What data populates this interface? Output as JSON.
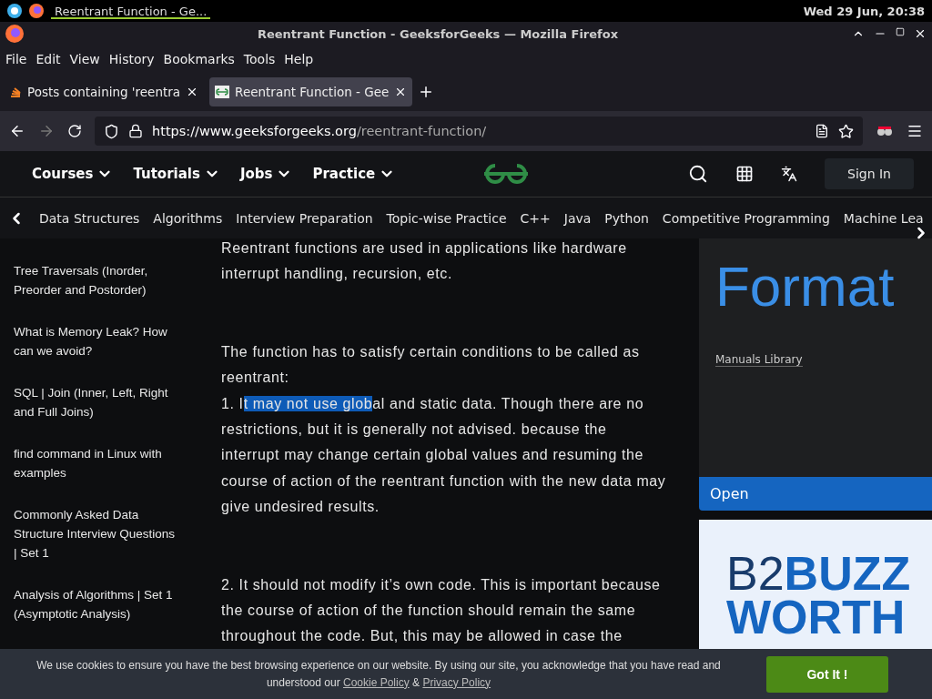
{
  "top_panel": {
    "task": "Reentrant Function - Ge...",
    "clock": "Wed 29 Jun, 20:38"
  },
  "window": {
    "title": "Reentrant Function - GeeksforGeeks — Mozilla Firefox"
  },
  "menu": [
    "File",
    "Edit",
    "View",
    "History",
    "Bookmarks",
    "Tools",
    "Help"
  ],
  "tabs": [
    {
      "label": "Posts containing 'reentra",
      "selected": false
    },
    {
      "label": "Reentrant Function - Gee",
      "selected": true
    }
  ],
  "url": {
    "host": "https://www.geeksforgeeks.org",
    "path": "/reentrant-function/"
  },
  "site_nav": {
    "items": [
      "Courses",
      "Tutorials",
      "Jobs",
      "Practice"
    ],
    "sign_in": "Sign In"
  },
  "categories": [
    "Data Structures",
    "Algorithms",
    "Interview Preparation",
    "Topic-wise Practice",
    "C++",
    "Java",
    "Python",
    "Competitive Programming",
    "Machine Lea"
  ],
  "sidebar": [
    "Tree Traversals (Inorder, Preorder and Postorder)",
    "What is Memory Leak? How can we avoid?",
    "SQL | Join (Inner, Left, Right and Full Joins)",
    "find command in Linux with examples",
    "Commonly Asked Data Structure Interview Questions | Set 1",
    "Analysis of Algorithms | Set 1 (Asymptotic Analysis)"
  ],
  "article": [
    [
      [
        {
          "text": "Reentrant functions are used in applications like hardware interrupt handling, recursion, etc.",
          "highlighted": false
        }
      ]
    ],
    [
      [
        {
          "text": "The function has to satisfy certain conditions to be called as reentrant:",
          "highlighted": false
        }
      ],
      [
        {
          "text": "1. I",
          "highlighted": false
        },
        {
          "text": "t may not use glob",
          "highlighted": true
        },
        {
          "text": "al and static data. Though there are no restrictions, but it is generally not advised. because the interrupt may change certain global values and resuming the course of action of the reentrant function with the new data may give undesired results.",
          "highlighted": false
        }
      ]
    ],
    [
      [
        {
          "text": "2. It should not modify it’s own code. This is important because the course of action of the function should remain the same throughout the code. But, this may be allowed in case the",
          "highlighted": false
        }
      ]
    ]
  ],
  "ad": {
    "headline": "Format",
    "brand": "Manuals Library",
    "button": "Open",
    "banner_light": "B2",
    "banner_bold": "BUZZ",
    "banner_line2": "WORTH"
  },
  "cookie": {
    "text": "We use cookies to ensure you have the best browsing experience on our website. By using our site, you acknowledge that you have read and understood our",
    "cookie_link": "Cookie Policy",
    "amp": "&",
    "privacy_link": "Privacy Policy",
    "button": "Got It !"
  }
}
